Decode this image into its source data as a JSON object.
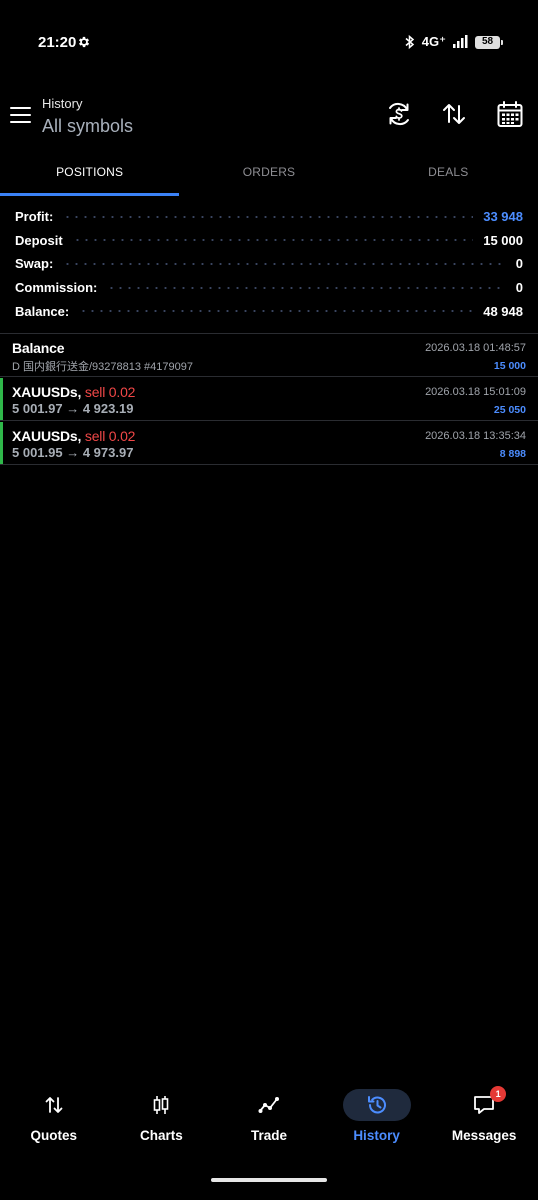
{
  "status_bar": {
    "time": "21:20",
    "network": "4G⁺",
    "battery": "58",
    "icons": [
      "gear-icon",
      "bluetooth-icon",
      "signal-icon",
      "battery-icon"
    ]
  },
  "header": {
    "title": "History",
    "subtitle": "All symbols",
    "actions": [
      "currency-exchange-icon",
      "sort-icon",
      "calendar-icon"
    ]
  },
  "tabs": [
    {
      "label": "POSITIONS",
      "active": true
    },
    {
      "label": "ORDERS",
      "active": false
    },
    {
      "label": "DEALS",
      "active": false
    }
  ],
  "summary": {
    "profit": {
      "label": "Profit:",
      "value": "33 948"
    },
    "deposit": {
      "label": "Deposit",
      "value": "15 000"
    },
    "swap": {
      "label": "Swap:",
      "value": "0"
    },
    "commission": {
      "label": "Commission:",
      "value": "0"
    },
    "balance": {
      "label": "Balance:",
      "value": "48 948"
    }
  },
  "deals": [
    {
      "symbol": "Balance",
      "side": "",
      "detail": "D 国内銀行送金/93278813 #4179097",
      "time": "2026.03.18 01:48:57",
      "amount": "15 000"
    },
    {
      "symbol": "XAUUSDs,",
      "side": "sell 0.02",
      "detail": "5 001.97 → 4 923.19",
      "time": "2026.03.18 15:01:09",
      "amount": "25 050"
    },
    {
      "symbol": "XAUUSDs,",
      "side": "sell 0.02",
      "detail": "5 001.95 → 4 973.97",
      "time": "2026.03.18 13:35:34",
      "amount": "8 898"
    }
  ],
  "bottom_nav": {
    "quotes": "Quotes",
    "charts": "Charts",
    "trade": "Trade",
    "history": "History",
    "messages": "Messages",
    "messages_badge": "1"
  },
  "colors": {
    "accent": "#3b82f6",
    "profit": "#4c8dff",
    "sell": "#f04747",
    "position_bar": "#2fb84a",
    "background": "#000000"
  }
}
